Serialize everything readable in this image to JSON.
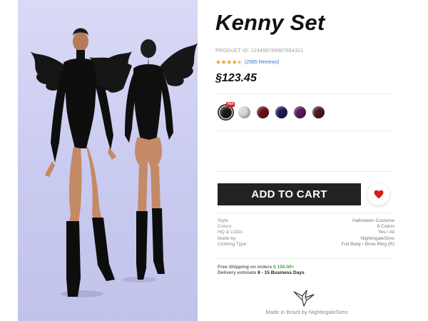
{
  "product": {
    "title": "Kenny Set",
    "product_id": "PRODUCT ID: 123456789987654321",
    "rating_stars": 4.5,
    "reviews": "(2585 Reviews)",
    "price": "§123.45"
  },
  "swatches": [
    {
      "color": "#1a1a1a",
      "selected": true,
      "badge": "Hot"
    },
    {
      "color": "#d8d8d8",
      "selected": false
    },
    {
      "color": "#6b1015",
      "selected": false
    },
    {
      "color": "#1c1d52",
      "selected": false
    },
    {
      "color": "#5a1860",
      "selected": false
    },
    {
      "color": "#4a1826",
      "selected": false
    }
  ],
  "actions": {
    "add_to_cart": "ADD TO CART"
  },
  "specs": {
    "style_label": "Style:",
    "style_value": "Halloween Costume",
    "colors_label": "Colors:",
    "colors_value": "6 Colors",
    "hq_label": "HQ & LODs:",
    "hq_value": "Yes / All",
    "made_label": "Made by:",
    "made_value": "NightingaleSims",
    "type_label": "Clothing Type:",
    "type_value": "Full Body / Brow Ring (R)"
  },
  "shipping": {
    "free_text": "Free Shipping on orders",
    "free_amount": "§ 150.00+",
    "delivery_text": "Delivery estimate",
    "delivery_days": "8 - 15 Business Days"
  },
  "footer": {
    "made_in": "Made in Brazil by NightingaleSims"
  },
  "colors": {
    "star": "#f0a51b",
    "heart": "#d81a1a",
    "button": "#222222",
    "accent_green": "#3fa33f"
  }
}
